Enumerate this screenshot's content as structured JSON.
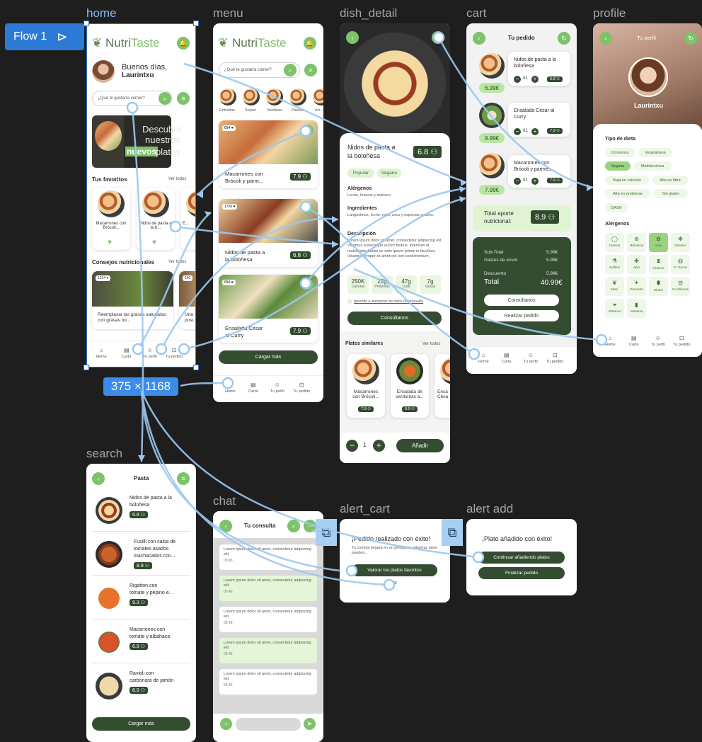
{
  "flow": {
    "label": "Flow 1",
    "size_badge": "375 × 1168"
  },
  "frames": {
    "home": "home",
    "menu": "menu",
    "dish_detail": "dish_detail",
    "cart": "cart",
    "profile": "profile",
    "search": "search",
    "chat": "chat",
    "alert_cart": "alert_cart",
    "alert_add": "alert add"
  },
  "brand": {
    "part1": "Nutri",
    "part2": "Taste",
    "accent": "#7ec26a",
    "dark": "#344d31"
  },
  "home": {
    "greeting": "Buenos días,",
    "username": "Laurintxu",
    "search_placeholder": "¿Qué te gustaría comer?",
    "banner_line1": "Descubre",
    "banner_line2": "nuestros",
    "banner_new": "nuevos",
    "banner_platos": "platos",
    "favorites_title": "Tus favoritos",
    "see_all": "Ver todos",
    "favorites": [
      {
        "name": "Macarrones con Brócoli..."
      },
      {
        "name": "Nidos de pasta a la b..."
      },
      {
        "name": "E..."
      }
    ],
    "tips_title": "Consejos nutricionales",
    "tips_see_all": "Ver todos",
    "tips": [
      {
        "likes": "1234 ♥",
        "text": "Reemplazar las grasas saturadas con grasas no..."
      },
      {
        "likes": "140",
        "text": "Una posi..."
      }
    ]
  },
  "nav": {
    "home": "Home",
    "carta": "Carta",
    "perfil": "Tu perfil",
    "pedido": "Tu pedido"
  },
  "menu": {
    "search_placeholder": "¿Qué te gustaría comer?",
    "categories": [
      "Entradas",
      "Sopas",
      "Verduras",
      "Pastas",
      "Arr..."
    ],
    "items": [
      {
        "likes": "654 ♥",
        "name_l1": "Macarrones con",
        "name_l2": "Brócoli y parm...",
        "price": "7.9"
      },
      {
        "likes": "1726 ♥",
        "name_l1": "Nidos de pasta a",
        "name_l2": "la boloñesa",
        "price": "6.8"
      },
      {
        "likes": "654 ♥",
        "name_l1": "Ensalada César",
        "name_l2": "al Curry",
        "price": "7.9"
      }
    ],
    "load_more": "Cargar más"
  },
  "dish": {
    "name_l1": "Nidos de pasta a",
    "name_l2": "la boloñesa",
    "price": "6.8",
    "tags": [
      "Popular",
      "Vegano"
    ],
    "allergens_title": "Alérgenos",
    "allergens": "Leche, huevos y marisco.",
    "ingredients_title": "Ingredientes",
    "ingredients": "Langostinos, leche, nata, coco y especias suaves.",
    "desc_title": "Descripción",
    "desc": "Lorem ipsum dolor sit amet, consectetur adipiscing elit. Vivamus scelerisque auctor finibus. Interdum et malesuada fames ac ante ipsum primis in faucibus. Vivamus tempor sit amet est non condimentum.",
    "nutri": [
      {
        "v": "250K",
        "l": "Calorías"
      },
      {
        "v": "23g",
        "l": "Proteínas"
      },
      {
        "v": "47g",
        "l": "Carb"
      },
      {
        "v": "7g",
        "l": "Grasa"
      }
    ],
    "info_link": "Aprende a interpretar los datos nutricionales",
    "consult": "Consúltanos",
    "similar_title": "Platos similares",
    "similar_see_all": "Ver todos",
    "similar": [
      {
        "name_l1": "Macarrones",
        "name_l2": "con Brócoli...",
        "price": "7.9"
      },
      {
        "name_l1": "Ensalada de",
        "name_l2": "verduritas a...",
        "price": "9.9"
      },
      {
        "name_l1": "Ensa",
        "name_l2": "Césa",
        "price": ""
      }
    ],
    "qty": "1",
    "add": "Añadir"
  },
  "cart": {
    "title": "Tu pedido",
    "items": [
      {
        "name_l1": "Nidos de pasta a la",
        "name_l2": "boloñesa",
        "price": "6.99€",
        "qty": "01",
        "pts": "6.8"
      },
      {
        "name_l1": "Ensalada César al",
        "name_l2": "Curry",
        "price": "9.99€",
        "qty": "01",
        "pts": "7.9"
      },
      {
        "name_l1": "Macarrones con",
        "name_l2": "Brócoli y parmes...",
        "price": "7.99€",
        "qty": "01",
        "pts": "7.9"
      }
    ],
    "total_label_l1": "Total aporte",
    "total_label_l2": "nutricional:",
    "total_value": "8.9",
    "subtotal_label": "Sub-Total",
    "subtotal": "5.99€",
    "shipping_label": "Gastos de envío",
    "shipping": "5.99€",
    "discount_label": "Descuento",
    "discount": "5.99€",
    "total_label": "Total",
    "total": "40.99€",
    "consult": "Consúltanos",
    "order": "Realizar pedido"
  },
  "profile": {
    "title": "Tu perfil",
    "username": "Laurintxu",
    "diet_title": "Tipo de dieta",
    "diets": [
      "Omnívora",
      "Vegetariana",
      "Vegana",
      "Mediterránea",
      "Baja en calorías",
      "Alta en fibra",
      "Alta en proteínas",
      "Sin gluten",
      "DASH"
    ],
    "allergens_title": "Alérgenos",
    "allergens": [
      "Huevos",
      "Moluscos",
      "Soja",
      "Sésamo",
      "Sulfitos",
      "Apio",
      "Lácteos",
      "Fr. Secos",
      "Maní",
      "Pescado",
      "Gluten",
      "Crustáceos",
      "Altramuz",
      "Mostaza"
    ]
  },
  "search": {
    "title": "Pasta",
    "items": [
      {
        "name_l1": "Nidos de pasta a la",
        "name_l2": "boloñesa",
        "name_l3": "",
        "price": "6.8"
      },
      {
        "name_l1": "Fusilli con salsa de",
        "name_l2": "tomates asados",
        "name_l3": "machacados con...",
        "price": "8.9"
      },
      {
        "name_l1": "Rigatton con",
        "name_l2": "tomate y pepino e...",
        "name_l3": "",
        "price": "9.3"
      },
      {
        "name_l1": "Macarrones con",
        "name_l2": "tomate y albahaca",
        "name_l3": "",
        "price": "6.9"
      },
      {
        "name_l1": "Ravioli con",
        "name_l2": "carbonara de jamón",
        "name_l3": "",
        "price": "8.9"
      }
    ],
    "load_more": "Cargar más"
  },
  "chat": {
    "title": "Tu consulta",
    "messages": [
      {
        "text": "Lorem ipsum dolor sit amet, consectetur adipiscing elit.",
        "time": "05:45",
        "green": false
      },
      {
        "text": "Lorem ipsum dolor sit amet, consectetur adipiscing elit.",
        "time": "05:46",
        "green": true
      },
      {
        "text": "Lorem ipsum dolor sit amet, consectetur adipiscing elit.",
        "time": "05:45",
        "green": false
      },
      {
        "text": "Lorem ipsum dolor sit amet, consectetur adipiscing elit.",
        "time": "05:46",
        "green": true
      },
      {
        "text": "Lorem ipsum dolor sit amet, consectetur adipiscing elit.",
        "time": "05:45",
        "green": false
      }
    ]
  },
  "alert_cart": {
    "title": "¡Pedido realizado con éxito!",
    "body": "Tu comida llegará en un periquete, mientras tanto puedes...",
    "btn1": "Valorar tus platos favoritos",
    "btn2": "Salir"
  },
  "alert_add": {
    "title": "¡Plato añadido con éxito!",
    "btn1": "Continuar añadiendo platos",
    "btn2": "Finalizar pedido"
  }
}
